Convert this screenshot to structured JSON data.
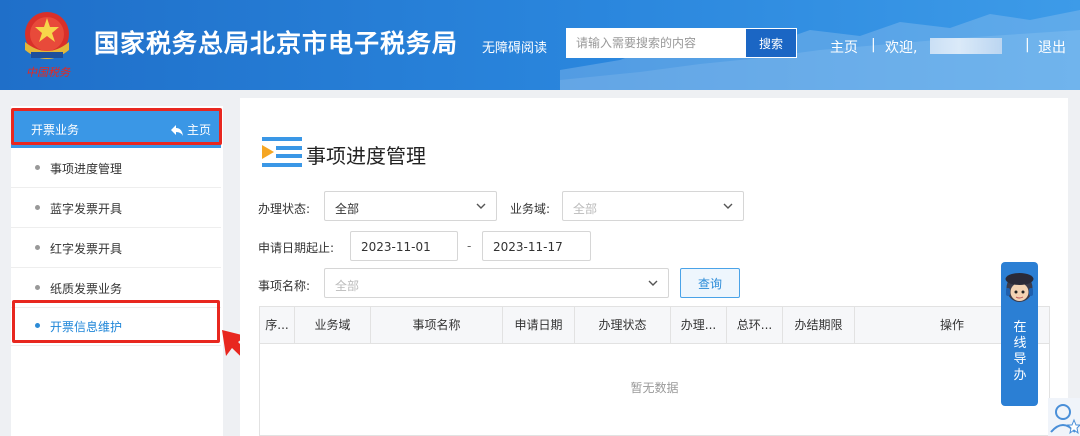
{
  "header": {
    "site_title": "国家税务总局北京市电子税务局",
    "accessibility_label": "无障碍阅读",
    "search_placeholder": "请输入需要搜索的内容",
    "search_button": "搜索",
    "nav_home": "主页",
    "welcome": "欢迎,",
    "logout": "退出",
    "separator": "|"
  },
  "sidebar": {
    "section_title": "开票业务",
    "home_link": "主页",
    "items": [
      {
        "label": "事项进度管理",
        "active": false
      },
      {
        "label": "蓝字发票开具",
        "active": false
      },
      {
        "label": "红字发票开具",
        "active": false
      },
      {
        "label": "纸质发票业务",
        "active": false
      },
      {
        "label": "开票信息维护",
        "active": true
      }
    ]
  },
  "main": {
    "page_title": "事项进度管理",
    "filters": {
      "status_label": "办理状态:",
      "status_value": "全部",
      "domain_label": "业务域:",
      "domain_placeholder": "全部",
      "date_label": "申请日期起止:",
      "date_start": "2023-11-01",
      "date_sep": "-",
      "date_end": "2023-11-17",
      "item_label": "事项名称:",
      "item_placeholder": "全部",
      "query_button": "查询"
    },
    "table": {
      "columns": [
        "序...",
        "业务域",
        "事项名称",
        "申请日期",
        "办理状态",
        "办理...",
        "总环...",
        "办结期限",
        "操作"
      ],
      "empty_text": "暂无数据"
    }
  },
  "guide": {
    "text": "在线导办"
  },
  "colors": {
    "header_blue": "#2a86dd",
    "accent_blue": "#3a97e6",
    "highlight_red": "#e8271f"
  }
}
